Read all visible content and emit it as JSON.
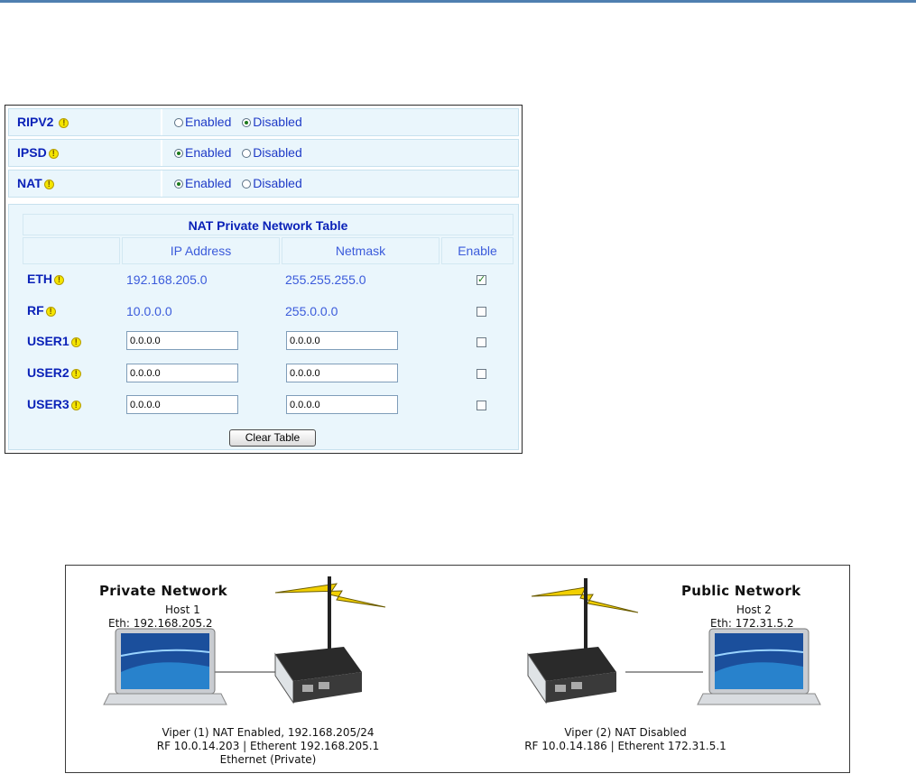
{
  "settings": {
    "rows": [
      {
        "label": "RIPV2",
        "options": [
          "Enabled",
          "Disabled"
        ],
        "selected": "Disabled"
      },
      {
        "label": "IPSD",
        "options": [
          "Enabled",
          "Disabled"
        ],
        "selected": "Enabled"
      },
      {
        "label": "NAT",
        "options": [
          "Enabled",
          "Disabled"
        ],
        "selected": "Enabled"
      }
    ]
  },
  "nat_table": {
    "title": "NAT Private Network Table",
    "headers": [
      "IP Address",
      "Netmask",
      "Enable"
    ],
    "rows": [
      {
        "label": "ETH",
        "ip": "192.168.205.0",
        "netmask": "255.255.255.0",
        "editable": false,
        "enabled": true
      },
      {
        "label": "RF",
        "ip": "10.0.0.0",
        "netmask": "255.0.0.0",
        "editable": false,
        "enabled": false
      },
      {
        "label": "USER1",
        "ip": "0.0.0.0",
        "netmask": "0.0.0.0",
        "editable": true,
        "enabled": false
      },
      {
        "label": "USER2",
        "ip": "0.0.0.0",
        "netmask": "0.0.0.0",
        "editable": true,
        "enabled": false
      },
      {
        "label": "USER3",
        "ip": "0.0.0.0",
        "netmask": "0.0.0.0",
        "editable": true,
        "enabled": false
      }
    ],
    "clear_button": "Clear Table"
  },
  "diagram": {
    "private": {
      "title": "Private Network",
      "host_name": "Host 1",
      "host_eth": "Eth: 192.168.205.2",
      "viper_line1": "Viper (1) NAT Enabled, 192.168.205/24",
      "viper_line2": "RF 10.0.14.203 | Etherent 192.168.205.1",
      "viper_line3": "Ethernet (Private)"
    },
    "public": {
      "title": "Public Network",
      "host_name": "Host 2",
      "host_eth": "Eth: 172.31.5.2",
      "viper_line1": "Viper (2) NAT Disabled",
      "viper_line2": "RF 10.0.14.186 | Etherent 172.31.5.1"
    }
  },
  "colors": {
    "label_blue": "#0b22b8",
    "value_blue": "#3b5bdb",
    "cell_bg": "#eaf6fc",
    "lightning": "#f2d000",
    "rule_blue": "#4f7fb0"
  },
  "icons": [
    "warning-icon",
    "laptop-icon",
    "router-icon",
    "antenna-icon",
    "lightning-icon"
  ]
}
